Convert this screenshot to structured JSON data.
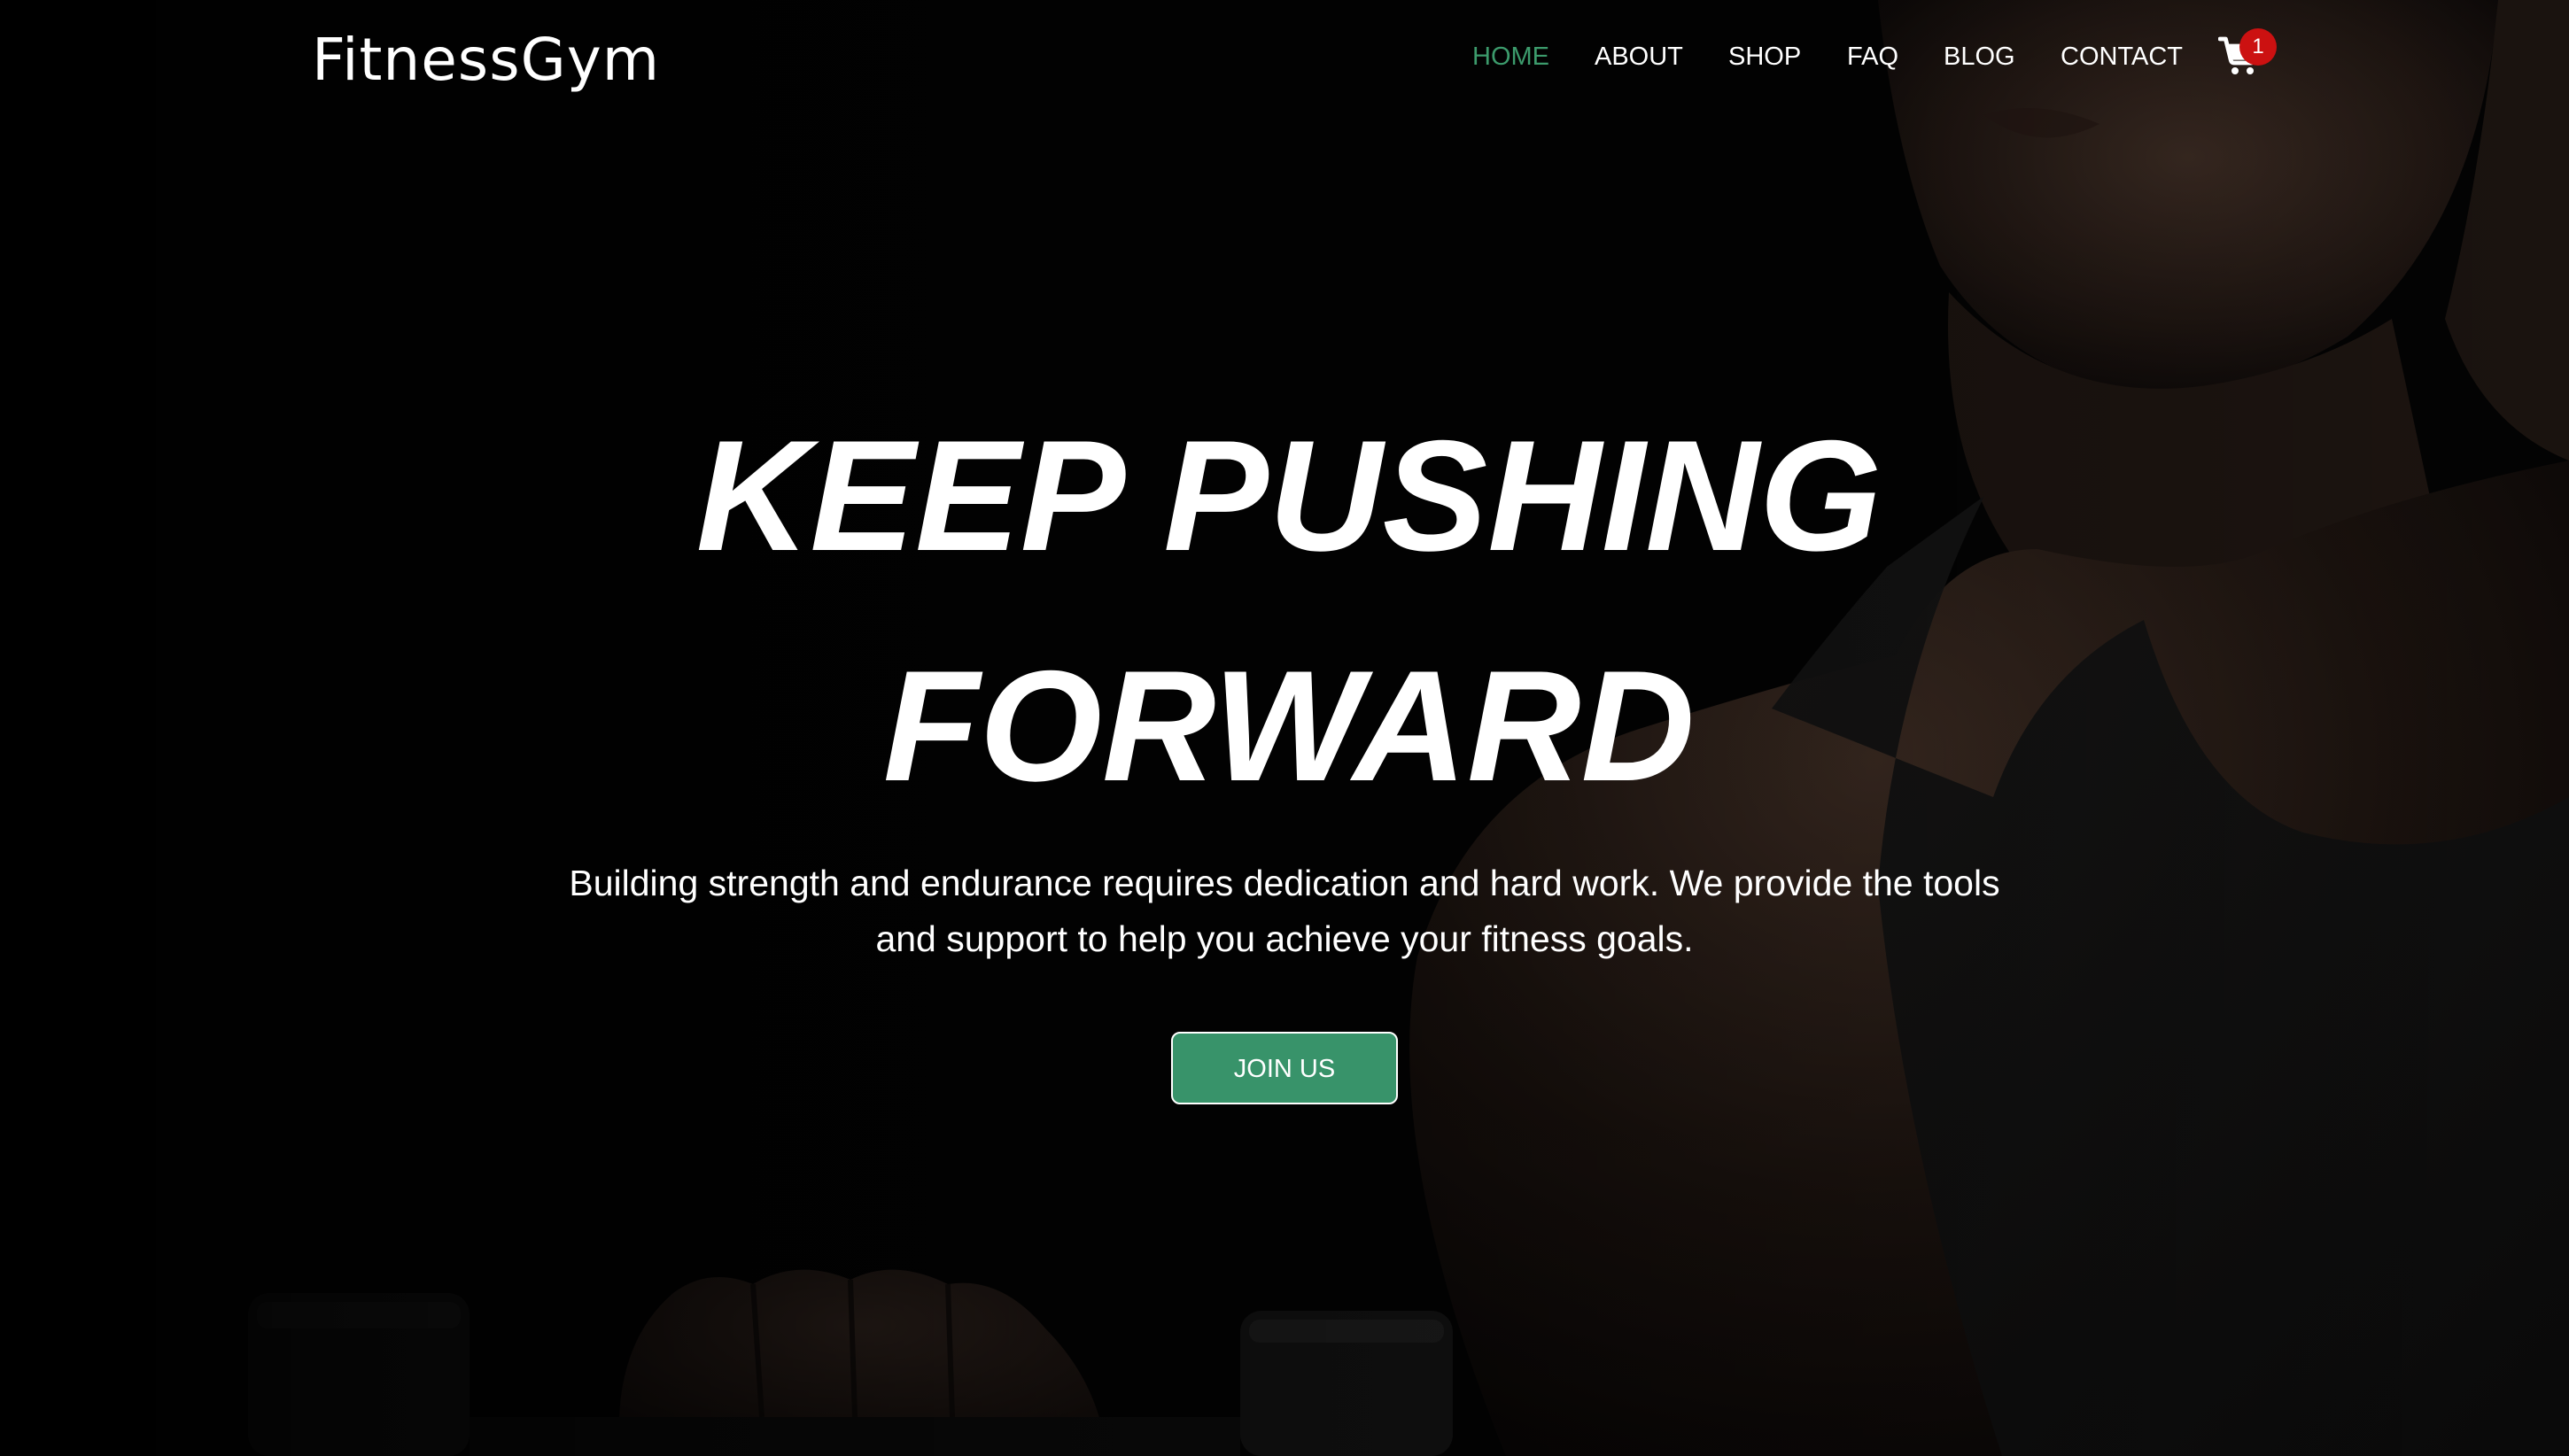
{
  "brand": {
    "logo_text": "FitnessGym"
  },
  "nav": {
    "items": [
      {
        "label": "HOME",
        "active": true
      },
      {
        "label": "ABOUT",
        "active": false
      },
      {
        "label": "SHOP",
        "active": false
      },
      {
        "label": "FAQ",
        "active": false
      },
      {
        "label": "BLOG",
        "active": false
      },
      {
        "label": "CONTACT",
        "active": false
      }
    ],
    "cart": {
      "icon": "shopping-cart-icon",
      "count": "1"
    }
  },
  "hero": {
    "title_line1": "KEEP PUSHING",
    "title_line2": "FORWARD",
    "description": "Building strength and endurance requires dedication and hard work. We provide the tools and support to help you achieve your fitness goals.",
    "cta_label": "JOIN US"
  },
  "colors": {
    "accent": "#3c9b6c",
    "button": "#38936a",
    "badge": "#cc1111",
    "background": "#030303"
  }
}
